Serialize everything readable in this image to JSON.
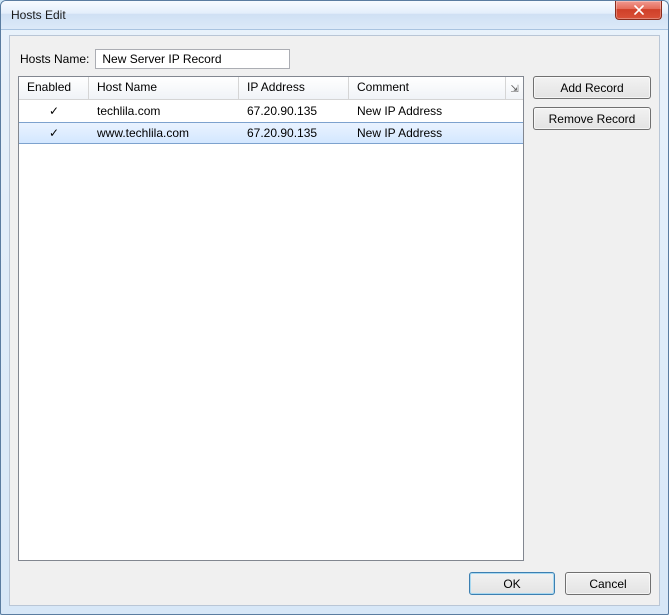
{
  "window": {
    "title": "Hosts Edit"
  },
  "nameRow": {
    "label": "Hosts Name:",
    "value": "New Server IP Record"
  },
  "columns": {
    "enabled": "Enabled",
    "host": "Host Name",
    "ip": "IP Address",
    "comment": "Comment"
  },
  "rows": [
    {
      "enabled": "✓",
      "host": "techlila.com",
      "ip": "67.20.90.135",
      "comment": "New IP Address",
      "selected": false
    },
    {
      "enabled": "✓",
      "host": "www.techlila.com",
      "ip": "67.20.90.135",
      "comment": "New IP Address",
      "selected": true
    }
  ],
  "buttons": {
    "add": "Add Record",
    "remove": "Remove Record",
    "ok": "OK",
    "cancel": "Cancel"
  },
  "icons": {
    "columnToggle": "⇲"
  }
}
